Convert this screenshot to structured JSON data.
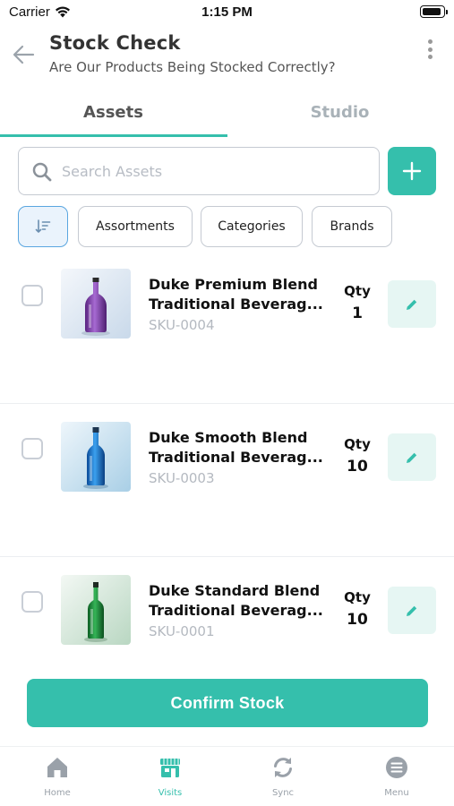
{
  "status_bar": {
    "carrier": "Carrier",
    "time": "1:15 PM"
  },
  "header": {
    "title": "Stock Check",
    "subtitle": "Are Our Products Being Stocked Correctly?"
  },
  "tabs": [
    {
      "label": "Assets",
      "active": true
    },
    {
      "label": "Studio",
      "active": false
    }
  ],
  "search": {
    "placeholder": "Search Assets",
    "value": ""
  },
  "filters": [
    "Assortments",
    "Categories",
    "Brands"
  ],
  "qty_label": "Qty",
  "products": [
    {
      "name_line1": "Duke Premium Blend",
      "name_line2": "Traditional Beverag...",
      "sku": "SKU-0004",
      "qty": "1",
      "bottle_color": "#8b3fb5",
      "bg": "#e4edf6",
      "checked": false
    },
    {
      "name_line1": "Duke Smooth Blend",
      "name_line2": "Traditional Beverag...",
      "sku": "SKU-0003",
      "qty": "10",
      "bottle_color": "#1f78d0",
      "bg": "#d9ecf6",
      "checked": false
    },
    {
      "name_line1": "Duke Standard Blend",
      "name_line2": "Traditional Beverag...",
      "sku": "SKU-0001",
      "qty": "10",
      "bottle_color": "#1f9a3a",
      "bg": "#e2efe6",
      "checked": false
    }
  ],
  "confirm_button": "Confirm Stock",
  "tabbar": [
    {
      "label": "Home",
      "icon": "home-icon",
      "active": false
    },
    {
      "label": "Visits",
      "icon": "store-icon",
      "active": true
    },
    {
      "label": "Sync",
      "icon": "sync-icon",
      "active": false
    },
    {
      "label": "Menu",
      "icon": "menu-icon",
      "active": false
    }
  ],
  "colors": {
    "accent": "#35bfac",
    "accent_light": "#e6f6f3",
    "muted": "#9aa1a9"
  }
}
